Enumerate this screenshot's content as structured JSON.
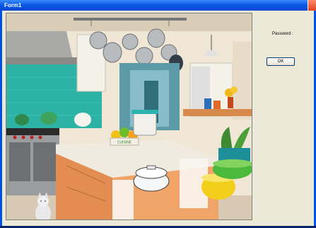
{
  "window": {
    "title": "Form1"
  },
  "form": {
    "password_label": "Password :",
    "ok_label": "OK"
  },
  "picture": {
    "caption_sign": "CUISINE"
  },
  "colors": {
    "titlebar": "#0a5ae8",
    "client": "#ece9d8",
    "backsplash": "#2bb0a8",
    "island": "#e8955a"
  }
}
